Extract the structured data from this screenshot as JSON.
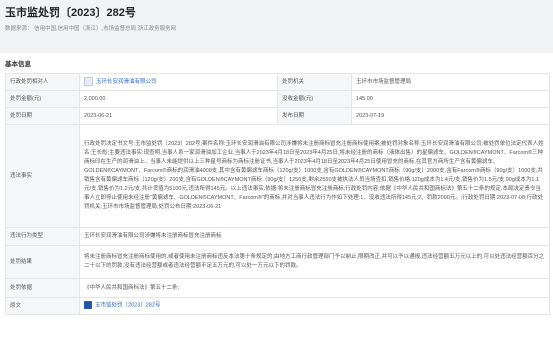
{
  "header": {
    "title": "玉市监处罚〔2023〕282号",
    "source": "数据来源： 信用中国,信用中国（浙江）,市场监督总局,浙江政务服务网"
  },
  "section": {
    "title": "基本信息"
  },
  "rows": {
    "party_label": "行政处罚相对人",
    "party_value": "玉环长安润滑油有限公司",
    "authority_label": "处罚机关",
    "authority_value": "玉环市市场监督管理局",
    "amount_label": "处罚金额(元)",
    "amount_value": "2,000.00",
    "confiscated_label": "没收金额(元)",
    "confiscated_value": "145.00",
    "date_label": "处罚日期",
    "date_value": "2023-06-21",
    "publish_label": "发布日期",
    "publish_value": "2023-07-19",
    "facts_label": "违法事实",
    "facts_value": "行政处罚决定书文号:玉市监处罚〔2023〕282号;案件名称:玉环长安润滑油有限公司涉嫌将未注册商标冒充注册商标使用案;被处罚对象名称:玉环长安润滑油有限公司;被处罚单位法定代表人姓名:王长彪;主要违法事实:现查明,当事人系一家润滑油加工企业,当事人于2023年4月18日至2023年4月25日,将未经注册的商标（液体出售）的星偏滤车、GOLDEN®CAYMONT、Farcom®三种商标印在生产的润滑油上。当事人未能提供以上三种星号商标为商标注册证书,当事人于2023年4月18日至2023年4月25日使用冒充的商标,在其官方商所生产含有黄偏滤车、GOLDEN®CAYMONT、Farcom®商标的润滑油4000支,其中含有黄偏滤车商标（120g/支）1000支,含有GOLDEN®CAYMONT商标（90g/支）2000支,含有Farcom®商标（90g/支）1000支,共销售含有黄偏滤车商标（120g/支）200支,含有GOLDEN®CAYMONT商标（90g/支）1250支,剩余2550支被执法人员当场查扣,销售价格:120g成本为1.4元/支,销售价为1.5元/支,90g成本为1.1元/支,销售价为1.2元/支,共计货值为5100元,违法所得145元。以上违法事实,依据:将未注册商标冒充注册商标;行政处罚内容:依据《中华人民共和国商标法》第五十二条的规定,本局决定责令当事人立即停止使用未经注册“黄偏滤车、GOLDEN®CAYMONT、Farcom®”的商标,并对当事人违法行为作如下处理:1、没收违法所得145元;2、罚款2000元。;行政处罚日期:2023-07-08;行政处罚机关:玉环市市场监督管理局;处罚公布日期:2023-06-21",
    "type_label": "违法行为类型",
    "type_value": "玉环长安润滑油有限公司涉嫌将未注册商标冒充注册商标",
    "result_label": "处罚结果",
    "result_value": "将未注册商标冒充注册商标使用的,或者使用未注册商标违反本法第十条规定的,由地方工商行政管理部门予以制止,限期改正,并可以予以通报,违法经营额五万元以上的,可以处违法经营额百分之二十以下的罚款,没有违法经营额或者违法经营额不足五万元的,可以处一万元以下的罚款。",
    "basis_label": "处罚依据",
    "basis_value": "《中华人民共和国商标法》第五十二条;",
    "original_label": "原文",
    "original_value": "玉市监处罚〔2023〕282号"
  }
}
